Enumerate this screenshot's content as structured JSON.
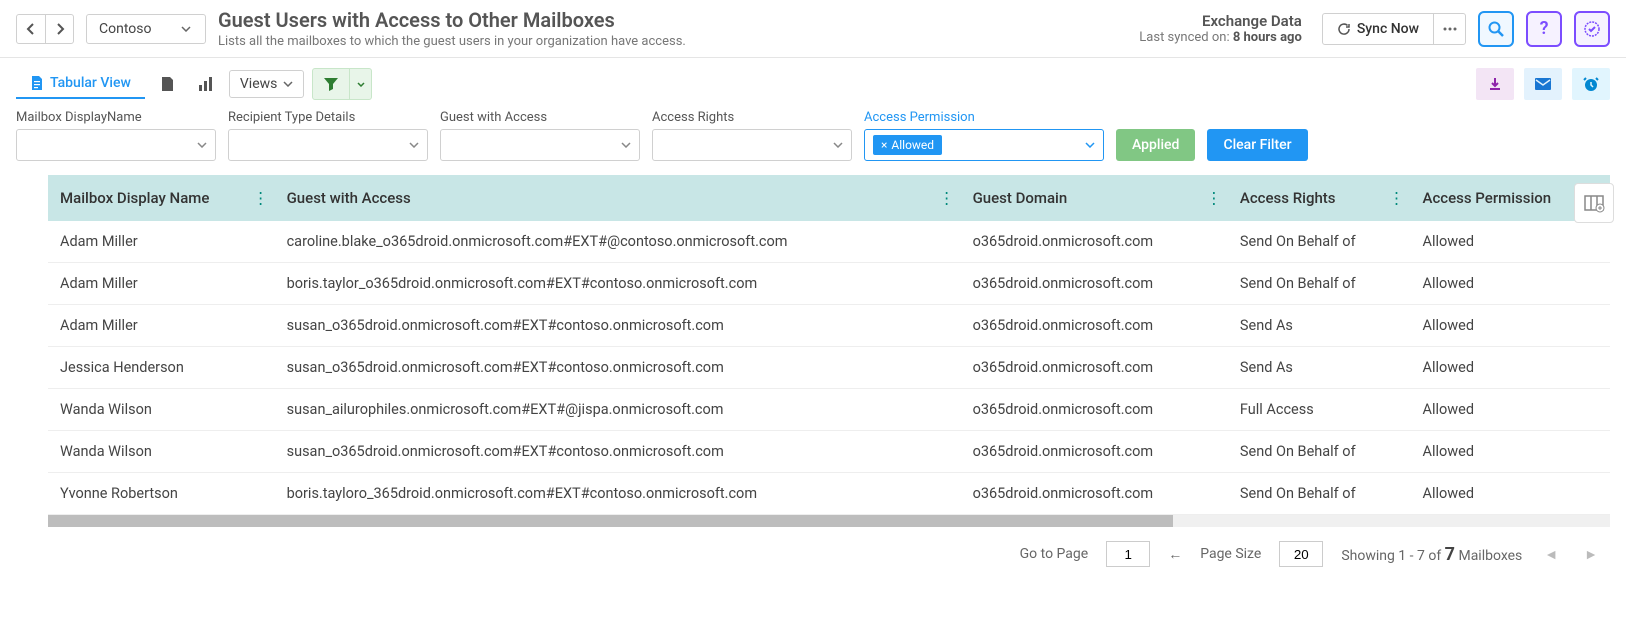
{
  "header": {
    "tenant": "Contoso",
    "title": "Guest Users with Access to Other Mailboxes",
    "subtitle": "Lists all the mailboxes to which the guest users in your organization have access.",
    "sync_title": "Exchange Data",
    "sync_prefix": "Last synced on: ",
    "sync_age": "8 hours ago",
    "sync_now": "Sync Now"
  },
  "toolbar": {
    "tabular_view": "Tabular View",
    "views": "Views"
  },
  "filters": {
    "labels": {
      "mailbox": "Mailbox DisplayName",
      "recipient": "Recipient Type Details",
      "guest": "Guest with Access",
      "rights": "Access Rights",
      "permission": "Access Permission"
    },
    "permission_chip": "Allowed",
    "applied": "Applied",
    "clear": "Clear Filter"
  },
  "columns": [
    "Mailbox Display Name",
    "Guest with Access",
    "Guest Domain",
    "Access Rights",
    "Access Permission"
  ],
  "rows": [
    {
      "mailbox": "Adam Miller",
      "guest": "caroline.blake_o365droid.onmicrosoft.com#EXT#@contoso.onmicrosoft.com",
      "domain": "o365droid.onmicrosoft.com",
      "rights": "Send On Behalf of",
      "perm": "Allowed"
    },
    {
      "mailbox": "Adam Miller",
      "guest": "boris.taylor_o365droid.onmicrosoft.com#EXT#contoso.onmicrosoft.com",
      "domain": "o365droid.onmicrosoft.com",
      "rights": "Send On Behalf of",
      "perm": "Allowed"
    },
    {
      "mailbox": "Adam Miller",
      "guest": "susan_o365droid.onmicrosoft.com#EXT#contoso.onmicrosoft.com",
      "domain": "o365droid.onmicrosoft.com",
      "rights": "Send As",
      "perm": "Allowed"
    },
    {
      "mailbox": "Jessica Henderson",
      "guest": "susan_o365droid.onmicrosoft.com#EXT#contoso.onmicrosoft.com",
      "domain": "o365droid.onmicrosoft.com",
      "rights": "Send As",
      "perm": "Allowed"
    },
    {
      "mailbox": "Wanda Wilson",
      "guest": "susan_ailurophiles.onmicrosoft.com#EXT#@jispa.onmicrosoft.com",
      "domain": "o365droid.onmicrosoft.com",
      "rights": "Full Access",
      "perm": "Allowed"
    },
    {
      "mailbox": "Wanda Wilson",
      "guest": "susan_o365droid.onmicrosoft.com#EXT#contoso.onmicrosoft.com",
      "domain": "o365droid.onmicrosoft.com",
      "rights": "Send On Behalf of",
      "perm": "Allowed"
    },
    {
      "mailbox": "Yvonne Robertson",
      "guest": "boris.tayloro_365droid.onmicrosoft.com#EXT#contoso.onmicrosoft.com",
      "domain": "o365droid.onmicrosoft.com",
      "rights": "Send On Behalf of",
      "perm": "Allowed"
    }
  ],
  "pager": {
    "goto_label": "Go to Page",
    "page": "1",
    "size_label": "Page Size",
    "size": "20",
    "showing_prefix": "Showing 1 - 7 of ",
    "total": "7",
    "showing_suffix": " Mailboxes"
  }
}
